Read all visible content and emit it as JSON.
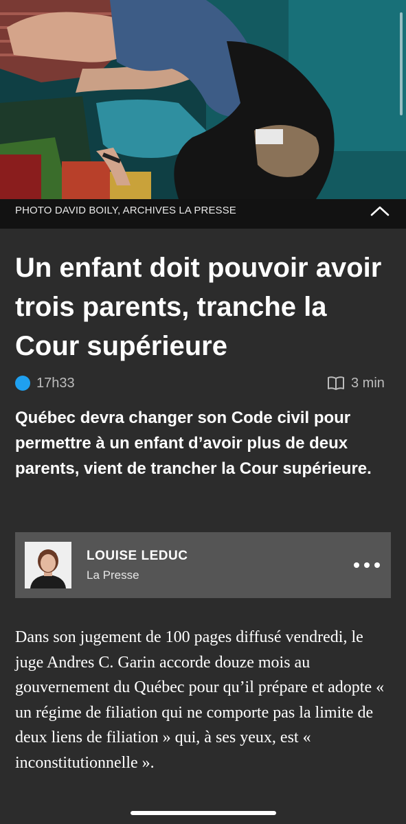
{
  "hero": {
    "caption": "PHOTO DAVID BOILY, ARCHIVES LA PRESSE",
    "collapse_icon": "chevron-up-icon"
  },
  "article": {
    "title": "Un enfant doit pouvoir avoir trois parents, tranche la Cour supérieure",
    "time": "17h33",
    "read_icon": "book-open-icon",
    "read_time": "3 min",
    "lede": "Québec devra changer son Code civil pour permettre à un enfant d’avoir plus de deux parents, vient de trancher la Cour supérieure.",
    "body": "Dans son jugement de 100 pages diffusé vendredi, le juge Andres C. Garin accorde douze mois au gouvernement du Québec pour qu’il prépare et adopte « un régime de filiation qui ne comporte pas la limite de deux liens de filiation » qui, à ses yeux, est « inconstitutionnelle »."
  },
  "author": {
    "name": "LOUISE LEDUC",
    "organization": "La Presse",
    "more_icon": "more-dots-icon"
  },
  "colors": {
    "background": "#2c2c2c",
    "live_dot": "#1fa0f0",
    "author_card": "#555555",
    "caption_bar": "#121212"
  }
}
